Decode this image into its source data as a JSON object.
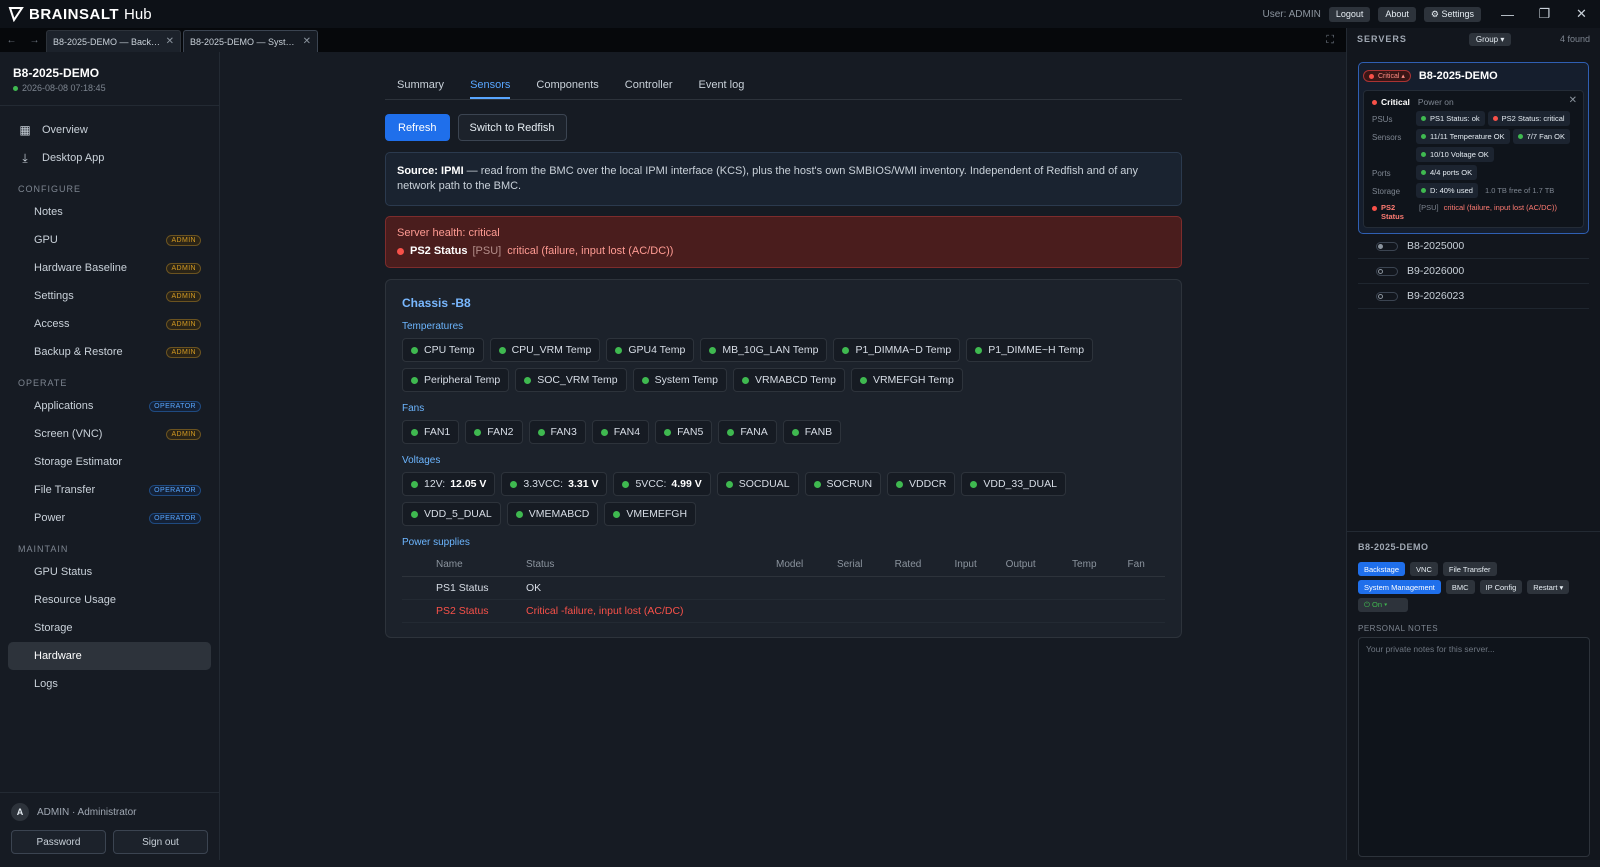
{
  "app": {
    "brand": "BRAINSALT",
    "product": "Hub",
    "user": "User: ADMIN",
    "logout": "Logout",
    "about": "About",
    "settings": "Settings"
  },
  "tabs": [
    {
      "label": "B8-2025-DEMO — Backstage",
      "active": false
    },
    {
      "label": "B8-2025-DEMO — System Management",
      "active": true
    }
  ],
  "sidebar": {
    "server": "B8-2025-DEMO",
    "timestamp": "2026-08-08 07:18:45",
    "top": [
      {
        "label": "Overview",
        "icon": "grid-icon"
      },
      {
        "label": "Desktop App",
        "icon": "download-icon"
      }
    ],
    "configure_title": "CONFIGURE",
    "configure": [
      {
        "label": "Notes",
        "badge": ""
      },
      {
        "label": "GPU",
        "badge": "ADMIN"
      },
      {
        "label": "Hardware Baseline",
        "badge": "ADMIN"
      },
      {
        "label": "Settings",
        "badge": "ADMIN"
      },
      {
        "label": "Access",
        "badge": "ADMIN"
      },
      {
        "label": "Backup & Restore",
        "badge": "ADMIN"
      }
    ],
    "operate_title": "OPERATE",
    "operate": [
      {
        "label": "Applications",
        "badge": "OPERATOR"
      },
      {
        "label": "Screen (VNC)",
        "badge": "ADMIN"
      },
      {
        "label": "Storage Estimator",
        "badge": ""
      },
      {
        "label": "File Transfer",
        "badge": "OPERATOR"
      },
      {
        "label": "Power",
        "badge": "OPERATOR"
      }
    ],
    "maintain_title": "MAINTAIN",
    "maintain": [
      {
        "label": "GPU Status",
        "active": false
      },
      {
        "label": "Resource Usage",
        "active": false
      },
      {
        "label": "Storage",
        "active": false
      },
      {
        "label": "Hardware",
        "active": true
      },
      {
        "label": "Logs",
        "active": false
      }
    ],
    "avatar": "A",
    "user": "ADMIN · Administrator",
    "password_btn": "Password",
    "signout_btn": "Sign out"
  },
  "main": {
    "tabs": [
      {
        "label": "Summary",
        "active": false
      },
      {
        "label": "Sensors",
        "active": true
      },
      {
        "label": "Components",
        "active": false
      },
      {
        "label": "Controller",
        "active": false
      },
      {
        "label": "Event log",
        "active": false
      }
    ],
    "refresh": "Refresh",
    "switch": "Switch to Redfish",
    "info_bold": "Source: IPMI",
    "info_text": " — read from the BMC over the local IPMI interface (KCS), plus the host's own SMBIOS/WMI inventory. Independent of Redfish and of any network path to the BMC.",
    "alert_title": "Server health: critical",
    "alert_item": "PS2 Status",
    "alert_tag": "[PSU]",
    "alert_msg": "critical (failure, input lost (AC/DC))",
    "chassis": "Chassis -B8",
    "temps_label": "Temperatures",
    "temps": [
      "CPU Temp",
      "CPU_VRM Temp",
      "GPU4 Temp",
      "MB_10G_LAN Temp",
      "P1_DIMMA~D Temp",
      "P1_DIMME~H Temp",
      "Peripheral Temp",
      "SOC_VRM Temp",
      "System Temp",
      "VRMABCD Temp",
      "VRMEFGH Temp"
    ],
    "fans_label": "Fans",
    "fans": [
      "FAN1",
      "FAN2",
      "FAN3",
      "FAN4",
      "FAN5",
      "FANA",
      "FANB"
    ],
    "volts_label": "Voltages",
    "volts": [
      {
        "name": "12V:",
        "value": "12.05 V"
      },
      {
        "name": "3.3VCC:",
        "value": "3.31 V"
      },
      {
        "name": "5VCC:",
        "value": "4.99 V"
      },
      {
        "name": "SOCDUAL",
        "value": ""
      },
      {
        "name": "SOCRUN",
        "value": ""
      },
      {
        "name": "VDDCR",
        "value": ""
      },
      {
        "name": "VDD_33_DUAL",
        "value": ""
      },
      {
        "name": "VDD_5_DUAL",
        "value": ""
      },
      {
        "name": "VMEMABCD",
        "value": ""
      },
      {
        "name": "VMEMEFGH",
        "value": ""
      }
    ],
    "psu_label": "Power supplies",
    "psu_headers": [
      "Name",
      "Status",
      "Model",
      "Serial",
      "Rated",
      "Input",
      "Output",
      "Temp",
      "Fan"
    ],
    "psu_rows": [
      {
        "name": "PS1 Status",
        "status": "OK",
        "bad": false
      },
      {
        "name": "PS2 Status",
        "status": "Critical -failure, input lost (AC/DC)",
        "bad": true
      }
    ]
  },
  "right": {
    "title": "SERVERS",
    "group": "Group ▾",
    "count": "4 found",
    "card": {
      "pill": "Critical ▴",
      "name": "B8-2025-DEMO",
      "state": "Critical",
      "power": "Power on",
      "psus_label": "PSUs",
      "psu1": "PS1 Status: ok",
      "psu2": "PS2 Status: critical",
      "sensors_label": "Sensors",
      "s1": "11/11 Temperature OK",
      "s2": "7/7 Fan OK",
      "s3": "10/10 Voltage OK",
      "ports_label": "Ports",
      "ports": "4/4 ports OK",
      "storage_label": "Storage",
      "storage": "D: 40% used",
      "storage_note": "1.0 TB free of 1.7 TB",
      "err_name": "PS2 Status",
      "err_tag": "[PSU]",
      "err_msg": "critical (failure, input lost (AC/DC))"
    },
    "servers": [
      "B8-2025000",
      "B9-2026000",
      "B9-2026023"
    ],
    "bottom_title": "B8-2025-DEMO",
    "row1": [
      "Backstage",
      "VNC",
      "File Transfer"
    ],
    "row2": [
      "System Management",
      "BMC",
      "IP Config",
      "Restart ▾"
    ],
    "power_btn": "⏻ On ▾",
    "notes_label": "PERSONAL NOTES",
    "notes_placeholder": "Your private notes for this server..."
  }
}
